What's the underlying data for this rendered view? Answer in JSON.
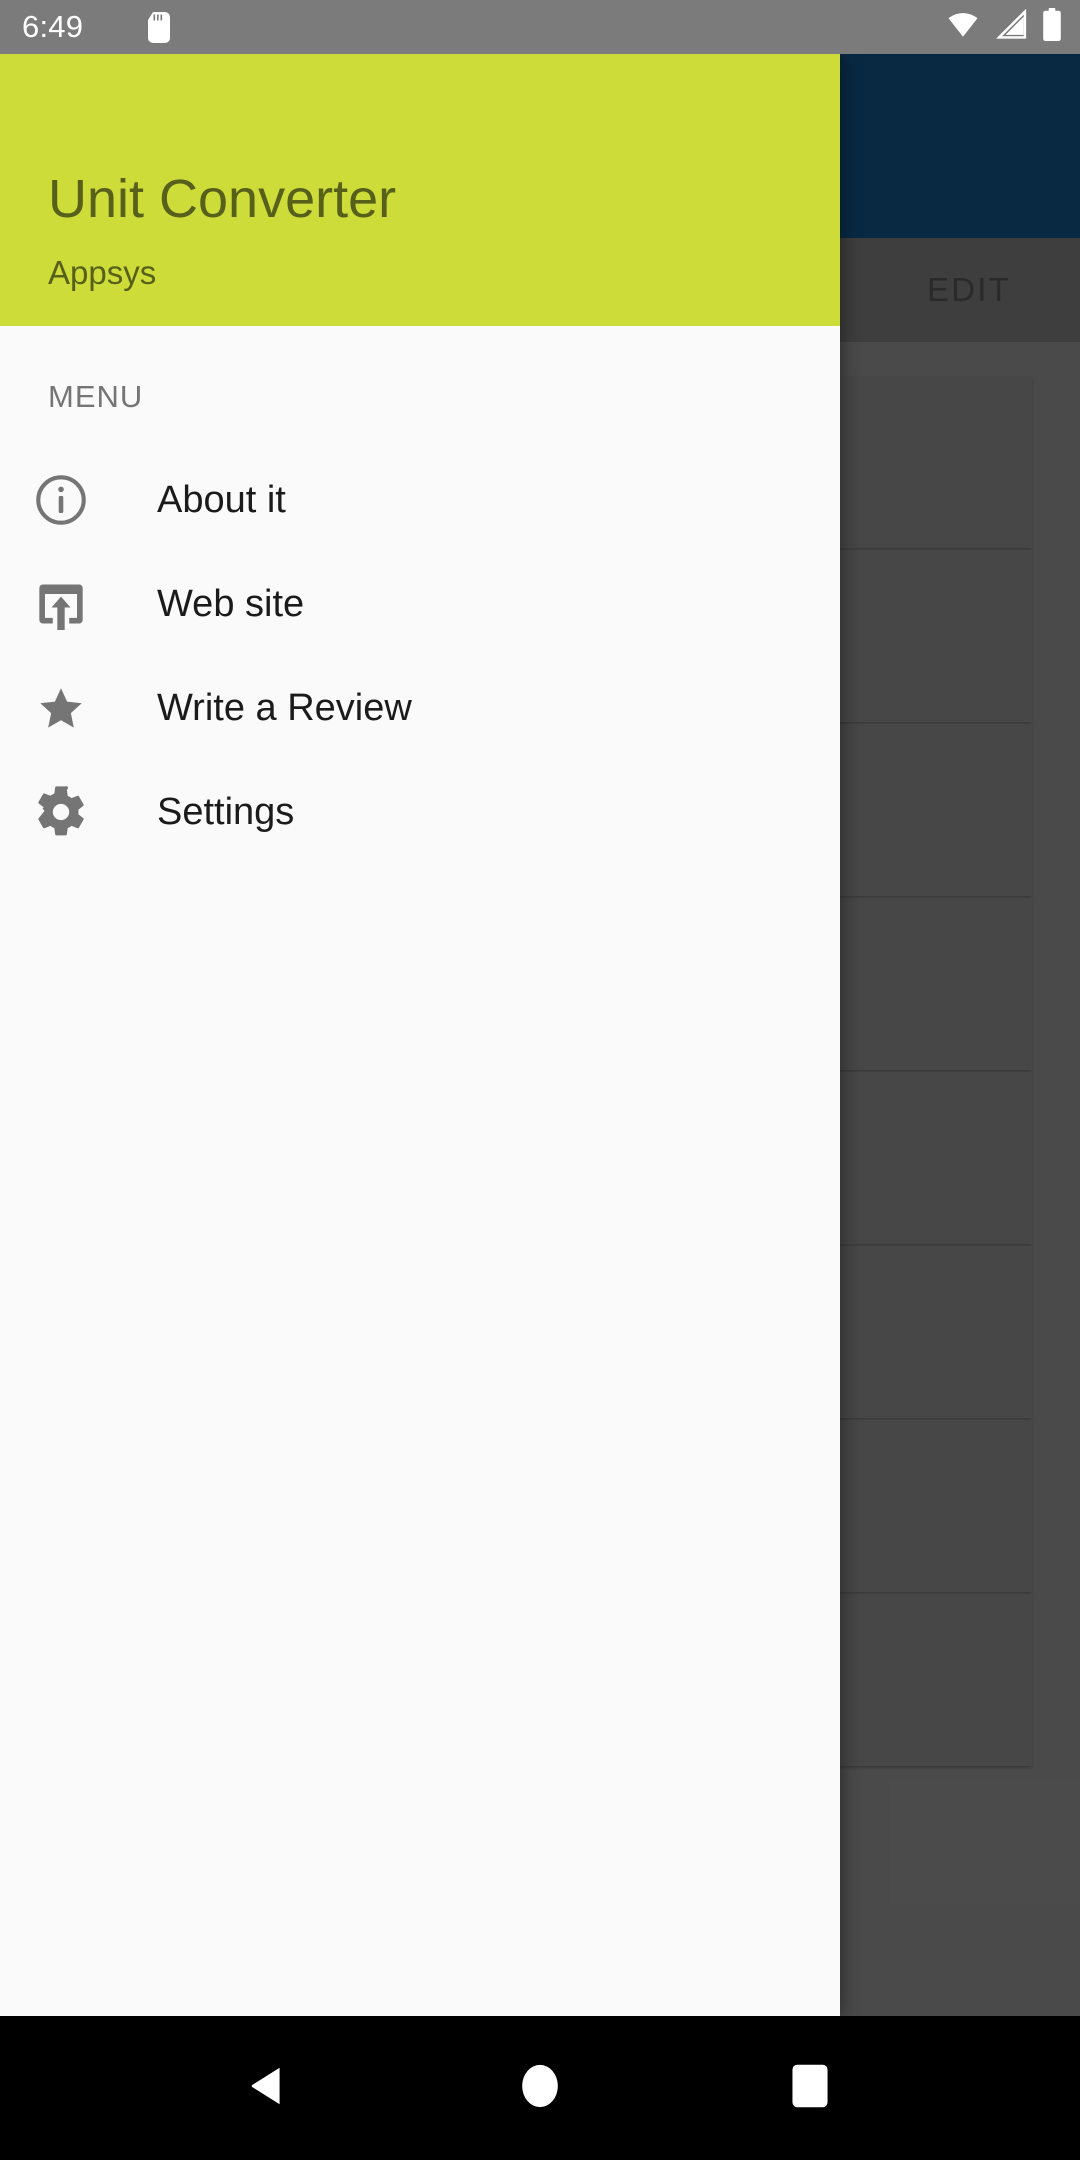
{
  "status_bar": {
    "time": "6:49",
    "icons": [
      "sd-card-icon",
      "wifi-icon",
      "cellular-signal-icon",
      "battery-icon"
    ]
  },
  "background_app": {
    "appbar_color": "#0d3c61",
    "tabs": [
      {
        "label": ""
      },
      {
        "label": ""
      },
      {
        "label": "EDIT"
      }
    ],
    "visible_tab_label": "EDIT",
    "card_count": 8
  },
  "drawer": {
    "header": {
      "title": "Unit Converter",
      "subtitle": "Appsys",
      "background_color": "#cddc39",
      "text_color": "#56601b"
    },
    "section_label": "MENU",
    "items": [
      {
        "label": "About it",
        "icon": "info-circle-icon"
      },
      {
        "label": "Web site",
        "icon": "open-in-new-icon"
      },
      {
        "label": "Write a Review",
        "icon": "star-icon"
      },
      {
        "label": "Settings",
        "icon": "gear-icon"
      }
    ]
  },
  "navigation_bar": {
    "buttons": [
      {
        "name": "back",
        "icon": "triangle-left-icon"
      },
      {
        "name": "home",
        "icon": "circle-icon"
      },
      {
        "name": "recents",
        "icon": "square-icon"
      }
    ]
  }
}
